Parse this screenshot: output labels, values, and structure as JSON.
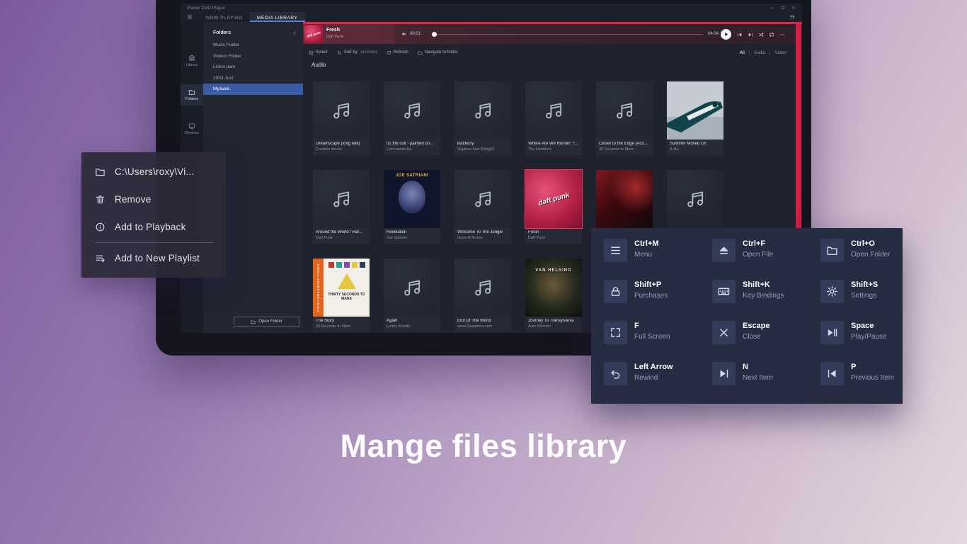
{
  "caption": "Mange files library",
  "window": {
    "titlebar": {
      "title": "Power DVD Player",
      "controls": [
        {
          "name": "minimize",
          "icon": "minimize"
        },
        {
          "name": "maximize",
          "icon": "maximize"
        },
        {
          "name": "close",
          "icon": "close"
        }
      ]
    },
    "tabs": [
      {
        "label": "NOW PLAYING",
        "active": false
      },
      {
        "label": "MEDIA LIBRARY",
        "active": true
      }
    ],
    "nav_rail": [
      {
        "label": "Library",
        "icon": "library",
        "active": false
      },
      {
        "label": "Folders",
        "icon": "folder",
        "active": true
      },
      {
        "label": "Devices",
        "icon": "devices",
        "active": false
      }
    ],
    "folders_panel": {
      "title": "Folders",
      "items": [
        {
          "label": "Music Folder",
          "selected": false
        },
        {
          "label": "Videos Folder",
          "selected": false
        },
        {
          "label": "Linkin park",
          "selected": false
        },
        {
          "label": "2003 Just",
          "selected": false
        },
        {
          "label": "Музыка",
          "selected": true
        }
      ],
      "open_folder": "Open Folder"
    },
    "player": {
      "thumb_text": "daft punk",
      "track_title": "Fresh",
      "track_artist": "Daft Punk",
      "elapsed": "00:01",
      "duration": "04:04"
    },
    "toolbar": {
      "items": [
        {
          "icon": "select-checkbox",
          "label": "Select"
        },
        {
          "icon": "sort-arrows",
          "label": "Sort by:",
          "value": "unsorted"
        },
        {
          "icon": "refresh",
          "label": "Refresh"
        },
        {
          "icon": "navigate-folder",
          "label": "Navigate to folder"
        }
      ],
      "filters": [
        {
          "label": "All",
          "active": true
        },
        {
          "label": "Audio",
          "active": false
        },
        {
          "label": "Video",
          "active": false
        }
      ]
    },
    "section_title": "Audio",
    "tiles": [
      {
        "title": "Dreamscape (long edit)",
        "artist": "Creative studio",
        "art": "note"
      },
      {
        "title": "01 the cult - painted on...",
        "artist": "UnknownArtist",
        "art": "note"
      },
      {
        "title": "Battlecry",
        "artist": "Nujabes feat.Shing02",
        "art": "note"
      },
      {
        "title": "Where Are We Runnin' ?...",
        "artist": "The Hooblers",
        "art": "note"
      },
      {
        "title": "Closer to the Edge (Aco...",
        "artist": "30 Seconds to Mars",
        "art": "note"
      },
      {
        "title": "Summer Moved On",
        "artist": "A-Ha",
        "art": "plane"
      },
      {
        "title": "Around the World / Har...",
        "artist": "Daft Punk",
        "art": "note"
      },
      {
        "title": "Revelation",
        "artist": "Joe Satriani",
        "art": "satriani",
        "art_text": "JOE SATRIANI"
      },
      {
        "title": "Welcome To The Jungle",
        "artist": "Guns N Roses",
        "art": "note"
      },
      {
        "title": "Fresh",
        "artist": "Daft Punk",
        "art": "daftpunk",
        "art_text": "daft punk",
        "selected": true
      },
      {
        "title": "",
        "artist": "",
        "art": "redphoto"
      },
      {
        "title": "",
        "artist": "",
        "art": "note"
      },
      {
        "title": "The Story",
        "artist": "30 Seconds to Mars",
        "art": "mars",
        "art_text": "THIRTY SECONDS TO MARS",
        "art_text2": "PIANO DREAMERS COVER"
      },
      {
        "title": "Again",
        "artist": "Lenny Kravitz",
        "art": "note"
      },
      {
        "title": "End Of The World",
        "artist": "www.Gusanero.com",
        "art": "note"
      },
      {
        "title": "Journey To Transylvania",
        "artist": "Alan Silvestri",
        "art": "vanhelsing",
        "art_text": "VAN HELSING"
      }
    ]
  },
  "context_menu": {
    "items": [
      {
        "icon": "folder",
        "label": "C:\\Users\\roxy\\Vi..."
      },
      {
        "icon": "trash",
        "label": "Remove"
      },
      {
        "icon": "info",
        "label": "Add to Playback"
      },
      {
        "icon": "playlist-add",
        "label": "Add to New Playlist",
        "divider_before": true
      }
    ]
  },
  "shortcuts_panel": {
    "items": [
      {
        "keys": "Ctrl+M",
        "action": "Menu",
        "icon": "menu"
      },
      {
        "keys": "Ctrl+F",
        "action": "Open File",
        "icon": "eject"
      },
      {
        "keys": "Ctrl+O",
        "action": "Open Folder",
        "icon": "folder"
      },
      {
        "keys": "Shift+P",
        "action": "Purchases",
        "icon": "lock"
      },
      {
        "keys": "Shift+K",
        "action": "Key Bindings",
        "icon": "keyboard"
      },
      {
        "keys": "Shift+S",
        "action": "Settings",
        "icon": "gear"
      },
      {
        "keys": "F",
        "action": "Full Screen",
        "icon": "fullscreen"
      },
      {
        "keys": "Escape",
        "action": "Close",
        "icon": "close"
      },
      {
        "keys": "Space",
        "action": "Play/Pause",
        "icon": "play-pause"
      },
      {
        "keys": "Left Arrow",
        "action": "Rewind",
        "icon": "rewind"
      },
      {
        "keys": "N",
        "action": "Next Item",
        "icon": "next"
      },
      {
        "keys": "P",
        "action": "Previous Item",
        "icon": "previous"
      }
    ]
  }
}
